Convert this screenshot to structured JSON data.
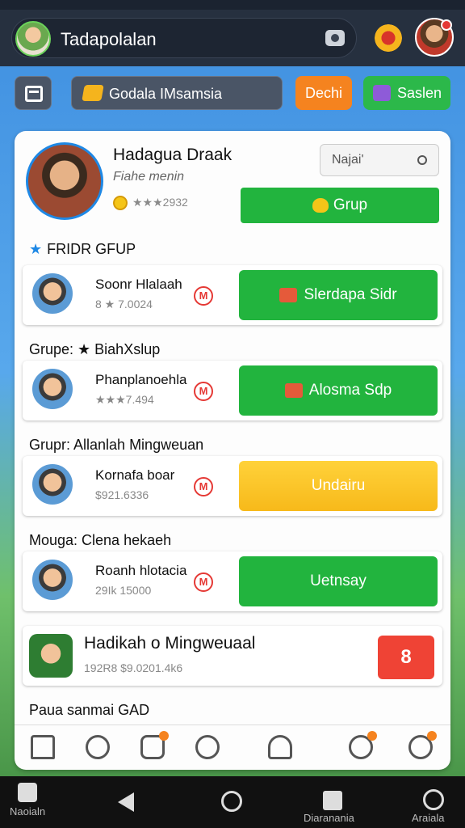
{
  "header": {
    "app_title": "Tadapolalan",
    "camera_icon": "camera-icon",
    "settings_icon": "gear-icon"
  },
  "filters": {
    "calendar_icon": "calendar-icon",
    "dropdown_label": "Godala IMsamsia",
    "button_orange_label": "Dechi",
    "button_green_label": "Saslen"
  },
  "profile": {
    "name": "Hadagua Draak",
    "subtitle": "Fiahe menin",
    "stats": "★★★2932",
    "mini_input_placeholder": "Najai'",
    "grup_button_label": "Grup"
  },
  "sections": {
    "first_header": "FRIDR GFUP",
    "group_1": "Grupe:  ★  BiahXslup",
    "group_2": "Grupr: Allanlah Mingweuan",
    "group_3": "Mouga:  Clena hekaeh"
  },
  "rows": [
    {
      "name": "Soonr Hlalaah",
      "meta": "8 ★ 7.0024",
      "button": "Slerdapa Sidr"
    },
    {
      "name": "Phanplanoehla",
      "meta": "★★★7.494",
      "button": "Alosma Sdp"
    },
    {
      "name": "Kornafa boar",
      "meta": "$921.6336",
      "button": "Undairu"
    },
    {
      "name": "Roanh hlotacia",
      "meta": "29Ik 15000",
      "button": "Uetnsay"
    }
  ],
  "footer_item": {
    "title": "Hadikah o Mingweuaal",
    "meta": "192R8   $9.0201.4k6",
    "red_button": "8"
  },
  "footer_line": "Paua sanmai GAD",
  "bottom_nav": {
    "left_label": "Naoialn",
    "center_label": "Diaranania",
    "right_label": "Araiala"
  },
  "colors": {
    "accent_green": "#22b43e",
    "accent_orange": "#f5831f",
    "accent_red": "#ef4335",
    "accent_yellow": "#f7b91a",
    "header_dark": "#26303f"
  }
}
